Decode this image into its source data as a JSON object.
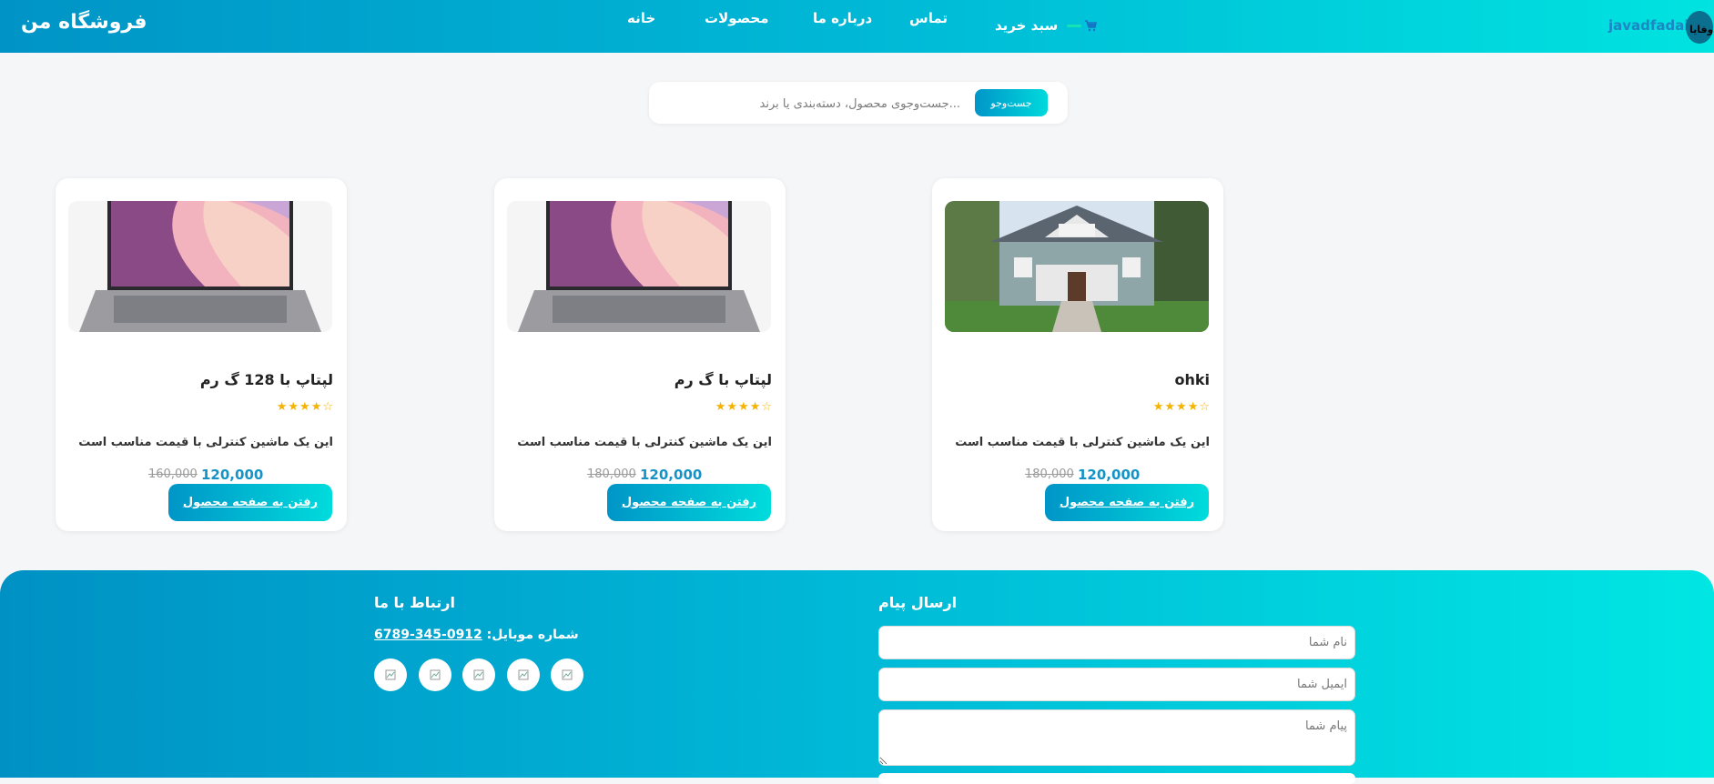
{
  "header": {
    "brand": "فروشگاه من",
    "nav": [
      "خانه",
      "محصولات",
      "درباره ما",
      "تماس"
    ],
    "cart_label": "سبد خرید",
    "username": "javadfadaii",
    "avatar_text": "وفایا"
  },
  "search": {
    "placeholder": "...جست‌وجوی محصول، دسته‌بندی یا برند",
    "button": "جست‌وجو"
  },
  "products": [
    {
      "title": "لپتاپ با 128 گ رم",
      "desc": "این یک ماشین کنترلی با قیمت مناسب است",
      "price": "120,000",
      "old_price": "160,000",
      "button": "رفتن به صفحه محصول",
      "image_icon": "laptop-image",
      "rating": 4.5
    },
    {
      "title": "لپتاپ با گ رم",
      "desc": "این یک ماشین کنترلی با قیمت مناسب است",
      "price": "120,000",
      "old_price": "180,000",
      "button": "رفتن به صفحه محصول",
      "image_icon": "laptop-image",
      "rating": 4.5
    },
    {
      "title": "ohki",
      "desc": "این یک ماشین کنترلی با قیمت مناسب است",
      "price": "120,000",
      "old_price": "180,000",
      "button": "رفتن به صفحه محصول",
      "image_icon": "house-image",
      "rating": 4.5
    }
  ],
  "footer": {
    "contact_title": "ارتباط با ما",
    "phone_label": "شماره موبایل:",
    "phone_number": "0912-345-6789",
    "message_title": "ارسال پیام",
    "name_placeholder": "نام شما",
    "email_placeholder": "ایمیل شما",
    "message_placeholder": "پیام شما",
    "social_icons": [
      "broken-image-icon",
      "broken-image-icon",
      "broken-image-icon",
      "broken-image-icon",
      "broken-image-icon"
    ]
  },
  "colors": {
    "accent_start": "#0094c6",
    "accent_end": "#00e3e0",
    "star": "#f5b301",
    "price": "#1593c7"
  }
}
